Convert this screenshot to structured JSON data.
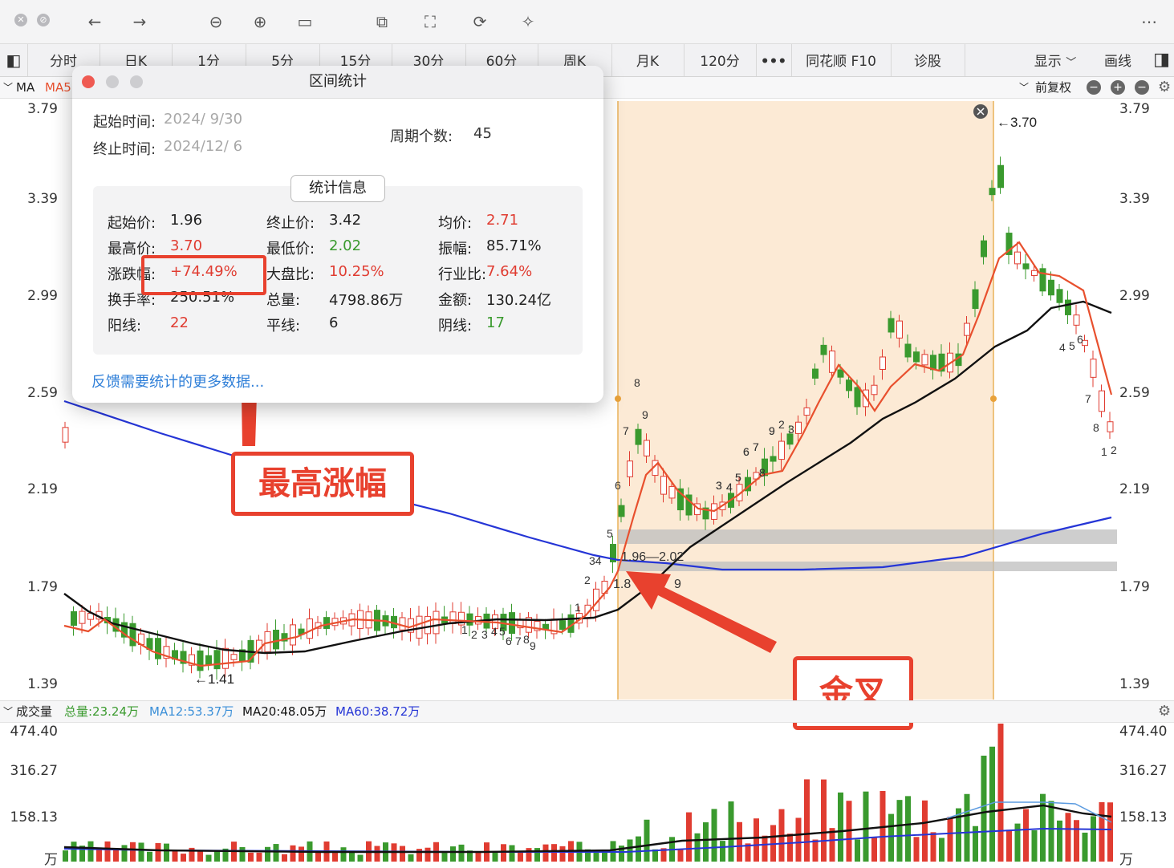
{
  "toolbar": {
    "icons": [
      "close-icon",
      "stop-icon",
      "back-arrow-icon",
      "forward-arrow-icon",
      "zoom-out-icon",
      "zoom-in-icon",
      "fit-width-icon",
      "copy-icon",
      "screenshot-icon",
      "rotate-icon",
      "magic-wand-icon",
      "more-icon"
    ]
  },
  "tabs": [
    "分时",
    "日K",
    "1分",
    "5分",
    "15分",
    "30分",
    "60分",
    "周K",
    "月K",
    "120分",
    "•••",
    "同花顺 F10",
    "诊股",
    "显示",
    "画线"
  ],
  "ma_row": {
    "label": "MA",
    "ma5": "MA5",
    "adjust": "前复权"
  },
  "price_axis": [
    "3.79",
    "3.39",
    "2.99",
    "2.59",
    "2.19",
    "1.79",
    "1.39"
  ],
  "chart_marks": {
    "high_label": "←3.70",
    "low_label": "←1.41",
    "range_label": "1.96—2.02",
    "range_label2": "1.8",
    "range_label3": "9",
    "seq_labels": [
      "1",
      "2",
      "3",
      "4",
      "5",
      "6",
      "7",
      "8",
      "9",
      "34",
      "5",
      "6",
      "7",
      "8",
      "9",
      "1",
      "2",
      "3",
      "4",
      "5",
      "6",
      "7",
      "8",
      "9",
      "2",
      "3",
      "4",
      "5",
      "6",
      "7",
      "8",
      "1",
      "2",
      "3",
      "4",
      "5",
      "6",
      "7",
      "8",
      "9"
    ]
  },
  "popup": {
    "title": "区间统计",
    "start_label": "起始时间:",
    "start_value": "2024/  9/30",
    "end_label": "终止时间:",
    "end_value": "2024/12/  6",
    "period_label": "周期个数:",
    "period_value": "45",
    "stat_header": "统计信息",
    "stats": [
      {
        "label": "起始价:",
        "value": "1.96",
        "color": "normal"
      },
      {
        "label": "终止价:",
        "value": "3.42",
        "color": "normal"
      },
      {
        "label": "均价:",
        "value": "2.71",
        "color": "red"
      },
      {
        "label": "最高价:",
        "value": "3.70",
        "color": "red"
      },
      {
        "label": "最低价:",
        "value": "2.02",
        "color": "green"
      },
      {
        "label": "振幅:",
        "value": "85.71%",
        "color": "normal"
      },
      {
        "label": "涨跌幅:",
        "value": "+74.49%",
        "color": "red"
      },
      {
        "label": "大盘比:",
        "value": "10.25%",
        "color": "red"
      },
      {
        "label": "行业比:",
        "value": "7.64%",
        "color": "red"
      },
      {
        "label": "换手率:",
        "value": "250.51%",
        "color": "normal"
      },
      {
        "label": "总量:",
        "value": "4798.86万",
        "color": "normal"
      },
      {
        "label": "金额:",
        "value": "130.24亿",
        "color": "normal"
      },
      {
        "label": "阳线:",
        "value": "22",
        "color": "red"
      },
      {
        "label": "平线:",
        "value": "6",
        "color": "normal"
      },
      {
        "label": "阴线:",
        "value": "17",
        "color": "green"
      }
    ],
    "feedback": "反馈需要统计的更多数据..."
  },
  "callouts": {
    "max_gain": "最高涨幅",
    "golden_cross": "金叉"
  },
  "volume": {
    "label": "成交量",
    "total": "总量:23.24万",
    "ma12": "MA12:53.37万",
    "ma20": "MA20:48.05万",
    "ma60": "MA60:38.72万",
    "axis": [
      "474.40",
      "316.27",
      "158.13",
      "万"
    ]
  },
  "chart_data": {
    "type": "candlestick",
    "price_axis_range": [
      1.39,
      3.79
    ],
    "selected_range": {
      "start": "2024/9/30",
      "end": "2024/12/6",
      "high": 3.7,
      "low_start": 1.96
    },
    "volume_axis_range": [
      0,
      474.4
    ],
    "colors": {
      "up": "#e03c31",
      "down": "#3a9a2e",
      "ma_short": "#e8502e",
      "ma_mid": "#111111",
      "ma_long": "#2535d6",
      "highlight": "#fbe3c7"
    }
  }
}
